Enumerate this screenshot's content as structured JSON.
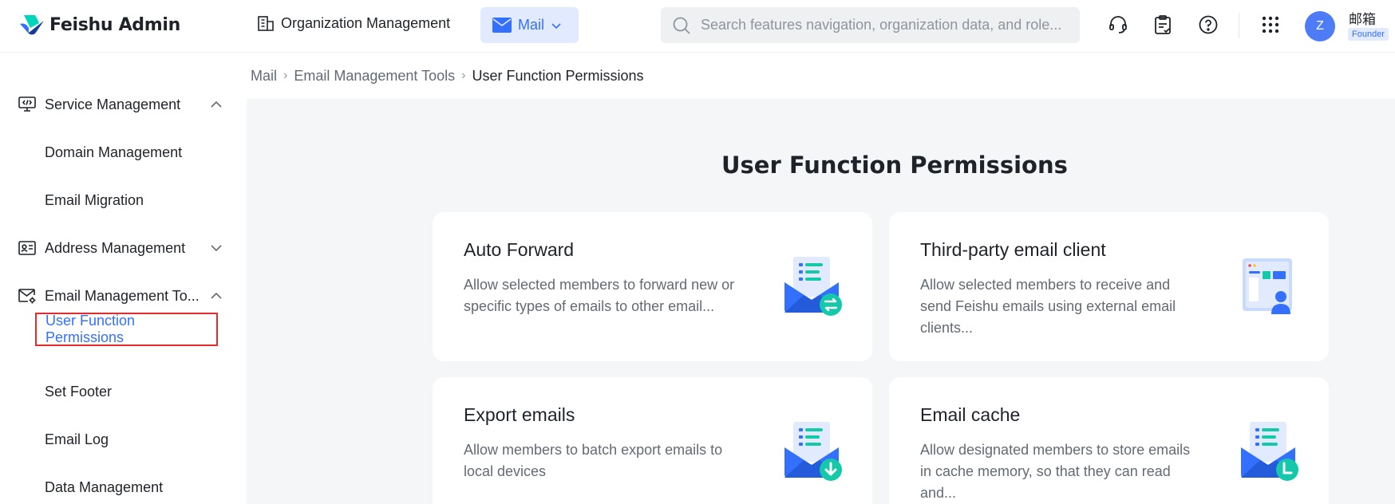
{
  "app": {
    "name": "Feishu Admin"
  },
  "header": {
    "org_label": "Organization Management",
    "mail_label": "Mail",
    "search_placeholder": "Search features navigation, organization data, and role...",
    "user_name": "邮箱",
    "user_role": "Founder",
    "avatar_letter": "Z",
    "icons": [
      "headset-icon",
      "clipboard-icon",
      "help-icon",
      "apps-grid-icon"
    ]
  },
  "sidebar": {
    "items": [
      {
        "label": "Service Management",
        "icon": "monitor-icon",
        "expanded": true
      },
      {
        "label": "Domain Management"
      },
      {
        "label": "Email Migration"
      },
      {
        "label": "Address Management",
        "icon": "contact-card-icon",
        "expanded": false
      },
      {
        "label": "Email Management To...",
        "icon": "mail-settings-icon",
        "expanded": true
      },
      {
        "label": "User Function Permissions",
        "active": true
      },
      {
        "label": "Set Footer"
      },
      {
        "label": "Email Log"
      },
      {
        "label": "Data Management"
      }
    ]
  },
  "breadcrumb": {
    "items": [
      "Mail",
      "Email Management Tools",
      "User Function Permissions"
    ]
  },
  "main": {
    "title": "User Function Permissions",
    "cards": [
      {
        "title": "Auto Forward",
        "desc": "Allow selected members to forward new or specific types of emails to other email...",
        "icon": "mail-forward-icon"
      },
      {
        "title": "Third-party email client",
        "desc": "Allow selected members to receive and send Feishu emails using external email clients...",
        "icon": "email-client-icon"
      },
      {
        "title": "Export emails",
        "desc": "Allow members to batch export emails to local devices",
        "icon": "mail-export-icon"
      },
      {
        "title": "Email cache",
        "desc": "Allow designated members to store emails in cache memory, so that they can read and...",
        "icon": "mail-cache-icon"
      }
    ]
  },
  "colors": {
    "accent": "#3370ff",
    "active_border": "#e22c2c",
    "teal": "#14c9a9",
    "background": "#f5f6f7"
  }
}
